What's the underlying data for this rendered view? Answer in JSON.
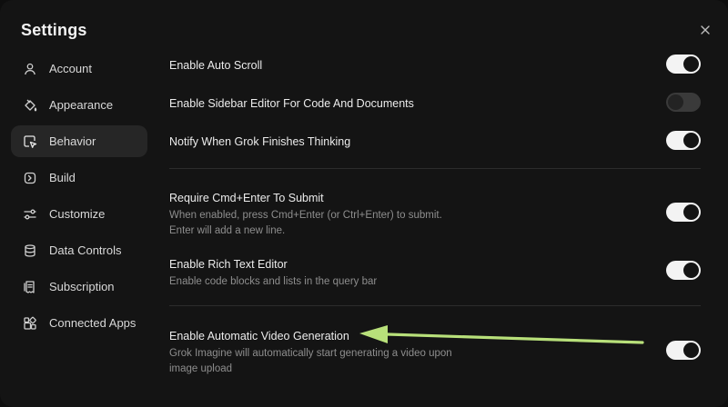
{
  "dialog": {
    "title": "Settings",
    "close_label": "×"
  },
  "sidebar": {
    "items": [
      {
        "label": "Account",
        "icon": "user-icon",
        "active": false
      },
      {
        "label": "Appearance",
        "icon": "paint-bucket-icon",
        "active": false
      },
      {
        "label": "Behavior",
        "icon": "cursor-window-icon",
        "active": true
      },
      {
        "label": "Build",
        "icon": "build-icon",
        "active": false
      },
      {
        "label": "Customize",
        "icon": "sliders-icon",
        "active": false
      },
      {
        "label": "Data Controls",
        "icon": "database-icon",
        "active": false
      },
      {
        "label": "Subscription",
        "icon": "receipt-icon",
        "active": false
      },
      {
        "label": "Connected Apps",
        "icon": "apps-icon",
        "active": false
      }
    ]
  },
  "settings": [
    {
      "title": "Enable Auto Scroll",
      "description": "",
      "enabled": true
    },
    {
      "title": "Enable Sidebar Editor For Code And Documents",
      "description": "",
      "enabled": false
    },
    {
      "title": "Notify When Grok Finishes Thinking",
      "description": "",
      "enabled": true
    },
    {
      "title": "Require Cmd+Enter To Submit",
      "description": "When enabled, press Cmd+Enter (or Ctrl+Enter) to submit. Enter will add a new line.",
      "enabled": true
    },
    {
      "title": "Enable Rich Text Editor",
      "description": "Enable code blocks and lists in the query bar",
      "enabled": true
    },
    {
      "title": "Enable Automatic Video Generation",
      "description": "Grok Imagine will automatically start generating a video upon image upload",
      "enabled": true
    }
  ],
  "annotation": {
    "arrow_color": "#b8e07a"
  },
  "colors": {
    "background": "#141414",
    "active_item": "#262626",
    "toggle_on": "#f3f3f3",
    "toggle_off": "#3a3a3a"
  }
}
